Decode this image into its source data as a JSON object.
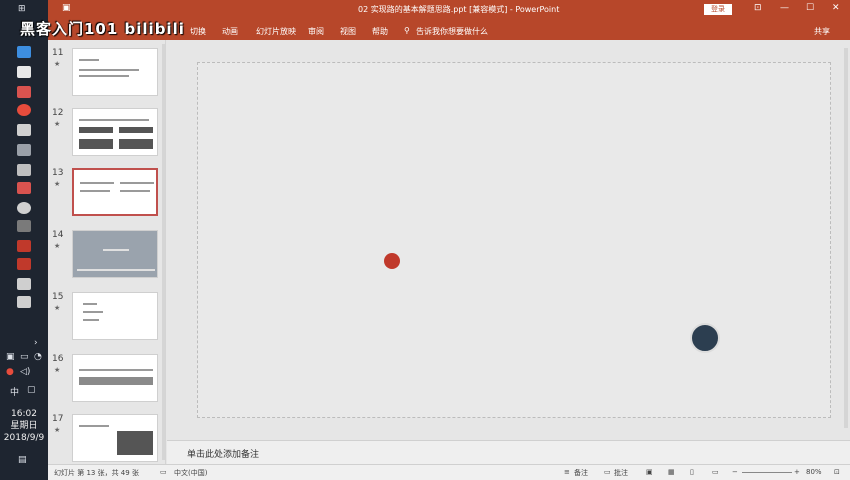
{
  "window": {
    "title": "02 实现路的基本解题思路.ppt [兼容模式] - PowerPoint",
    "login_label": "登录",
    "share_label": "共享",
    "tell_me": "告诉我你想要做什么"
  },
  "watermark": "黑客入门101 bilibili",
  "ribbon": {
    "tabs": [
      "切换",
      "动画",
      "幻灯片放映",
      "审阅",
      "视图",
      "帮助"
    ]
  },
  "taskbar": {
    "time": "16:02",
    "weekday": "星期日",
    "date": "2018/9/9",
    "ime": "中"
  },
  "thumbnails": [
    {
      "num": "11",
      "star": "★"
    },
    {
      "num": "12",
      "star": "★"
    },
    {
      "num": "13",
      "star": "★"
    },
    {
      "num": "14",
      "star": "★"
    },
    {
      "num": "15",
      "star": "★"
    },
    {
      "num": "16",
      "star": "★"
    },
    {
      "num": "17",
      "star": "★"
    }
  ],
  "notes": {
    "placeholder": "单击此处添加备注"
  },
  "status": {
    "slide_info": "幻灯片 第 13 张，共 49 张",
    "language": "中文(中国)",
    "notes_btn": "备注",
    "comments_btn": "批注",
    "zoom": "80%"
  },
  "colors": {
    "ribbon": "#b7472a",
    "taskbar": "#1e2530"
  }
}
